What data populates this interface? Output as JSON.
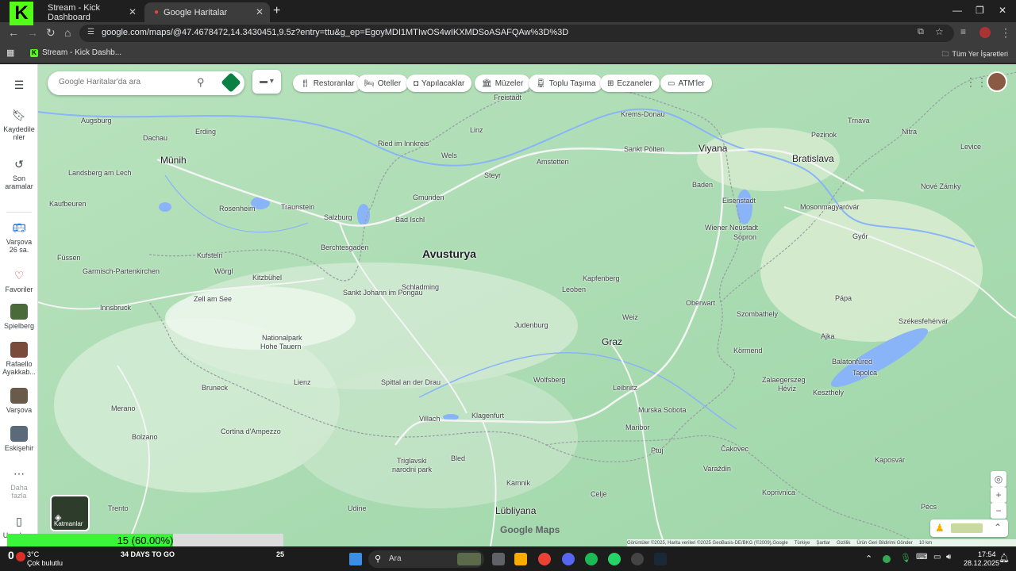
{
  "browser": {
    "tabs": [
      {
        "label": "Stream - Kick Dashboard"
      },
      {
        "label": "Google Haritalar"
      }
    ],
    "url": "google.com/maps/@47.4678472,14.3430451,9.5z?entry=ttu&g_ep=EgoyMDI1MTIwOS4wIKXMDSoASAFQAw%3D%3D",
    "bookmark": "Stream - Kick Dashb...",
    "all_bookmarks": "Tüm Yer İşaretleri"
  },
  "maps": {
    "search_placeholder": "Google Haritalar'da ara",
    "chips": [
      {
        "label": "Restoranlar",
        "icon": "fork-knife-icon"
      },
      {
        "label": "Oteller",
        "icon": "bed-icon"
      },
      {
        "label": "Yapılacaklar",
        "icon": "camera-icon"
      },
      {
        "label": "Müzeler",
        "icon": "museum-icon"
      },
      {
        "label": "Toplu Taşıma",
        "icon": "train-icon"
      },
      {
        "label": "Eczaneler",
        "icon": "pharmacy-icon"
      },
      {
        "label": "ATM'ler",
        "icon": "atm-icon"
      }
    ],
    "rail": {
      "saved": "Kaydedilenler",
      "saved_l1": "Kaydedile",
      "saved_l2": "nler",
      "recent_l1": "Son",
      "recent_l2": "aramalar",
      "warsaw_l1": "Varşova",
      "warsaw_l2": "26 sa.",
      "favorites": "Favoriler",
      "spielberg": "Spielberg",
      "rafaello_l1": "Rafaello",
      "rafaello_l2": "Ayakkab...",
      "warsaw2": "Varşova",
      "eskisehir": "Eskişehir",
      "more_l1": "Daha",
      "more_l2": "fazla",
      "uygulama": "Uygulama"
    },
    "layers_label": "Katmanlar",
    "brand": "Google Maps",
    "attribution": [
      "Görüntüler ©2025, Harita verileri ©2025 GeoBasis-DE/BKG (©2009),Google",
      "Türkiye",
      "Şartlar",
      "Gizlilik",
      "Ürün Geri Bildirimi Gönder",
      "10 km"
    ],
    "places": {
      "country": "Avusturya",
      "vienna": "Viyana",
      "bratislava": "Bratislava",
      "munich": "Münih",
      "graz": "Graz",
      "ljubljana": "Lübliyana",
      "salzburg": "Salzburg",
      "linz": "Linz",
      "innsbruck": "Innsbruck",
      "klagenfurt": "Klagenfurt",
      "villach": "Villach",
      "bolzano": "Bolzano",
      "trento": "Trento",
      "gyor": "Győr",
      "szombathely": "Szombathely",
      "szekesfehervar": "Székesfehérvár",
      "maribor": "Maribor",
      "augsburg": "Augsburg",
      "leoben": "Leoben",
      "kapfenberg": "Kapfenberg",
      "sopron": "Sopron",
      "bled": "Bled",
      "pecs": "Pécs",
      "kufstein": "Kufstein",
      "rosenheim": "Rosenheim",
      "hohe_tauern_1": "Nationalpark",
      "hohe_tauern_2": "Hohe Tauern",
      "triglav_1": "Triglavski",
      "triglav_2": "narodni park",
      "nitra": "Nitra",
      "trnava": "Trnava",
      "kecskemet": "Keszthely",
      "papa": "Pápa",
      "tapolca": "Tapolca",
      "zell": "Zell am See",
      "schladming": "Schladming",
      "judenburg": "Judenburg",
      "wolfsberg": "Wolfsberg",
      "spittal": "Spittal an der Drau",
      "lienz": "Lienz",
      "bruneck": "Bruneck",
      "meran": "Merano",
      "cortina": "Cortina d'Ampezzo",
      "steyr": "Steyr",
      "wels": "Wels",
      "st_polten": "Sankt Pölten",
      "krems": "Krems-Donau",
      "gmunden": "Gmunden",
      "freistadt": "Freistadt",
      "amstetten": "Amstetten",
      "udine": "Udine",
      "kamnik": "Kamnik",
      "celje": "Celje",
      "ptuj": "Ptuj",
      "murska": "Murska Sobota",
      "varazdin": "Varaždin",
      "zalaegerszeg": "Zalaegerszeg",
      "heviz": "Hévíz",
      "ajka": "Ajka",
      "kormend": "Körmend",
      "oberwart": "Oberwart",
      "eisenstadt": "Eisenstadt",
      "mosonmagyarovar": "Mosonmagyaróvár",
      "leibnitz": "Leibnitz",
      "weiz": "Weiz",
      "kaufbeuren": "Kaufbeuren",
      "landsberg": "Landsberg am Lech",
      "fussen": "Füssen",
      "garmisch": "Garmisch-Partenkirchen",
      "traunstein": "Traunstein",
      "berchtesgaden": "Berchtesgaden",
      "bad_ischl": "Bad Ischl",
      "worgl": "Wörgl",
      "kitzbuhel": "Kitzbühel",
      "st_johann": "Sankt Johann im Pongau",
      "erding": "Erding",
      "dachau": "Dachau",
      "ried": "Ried im Innkreis",
      "baden": "Baden",
      "wiener_neustadt": "Wiener Neustadt",
      "novezamky": "Nové Zámky",
      "levice": "Levice",
      "szekesfeh_lake": "Balatonfüred",
      "pezinok": "Pezinok",
      "kaposvar": "Kaposvár",
      "koprivnica": "Koprivnica",
      "cakovec": "Čakovec"
    }
  },
  "overlay": {
    "progress_text": "15 (60.00%)",
    "progress_fraction": 0.6
  },
  "taskbar": {
    "weather_temp": "3°C",
    "weather_desc": "Çok bulutlu",
    "notif_count": "0",
    "banner": "34 DAYS TO GO",
    "banner_num": "25",
    "search": "Ara",
    "time": "17:54",
    "date": "28.12.2025"
  }
}
